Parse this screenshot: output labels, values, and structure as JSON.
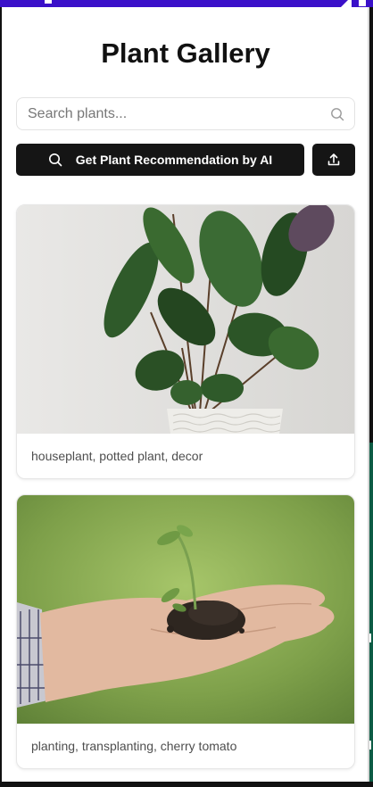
{
  "app": {
    "title": "Plant Gallery"
  },
  "search": {
    "placeholder": "Search plants...",
    "value": "",
    "icon": "search-icon"
  },
  "actions": {
    "ai_button_label": "Get Plant Recommendation by AI",
    "ai_button_icon": "search-icon",
    "upload_icon": "upload-icon"
  },
  "gallery": {
    "items": [
      {
        "tags": "houseplant, potted plant, decor"
      },
      {
        "tags": "planting, transplanting, cherry tomato"
      }
    ]
  },
  "theme": {
    "status_bar": "#3a10c9",
    "button_bg": "#151515",
    "page_bg": "#ffffff"
  }
}
